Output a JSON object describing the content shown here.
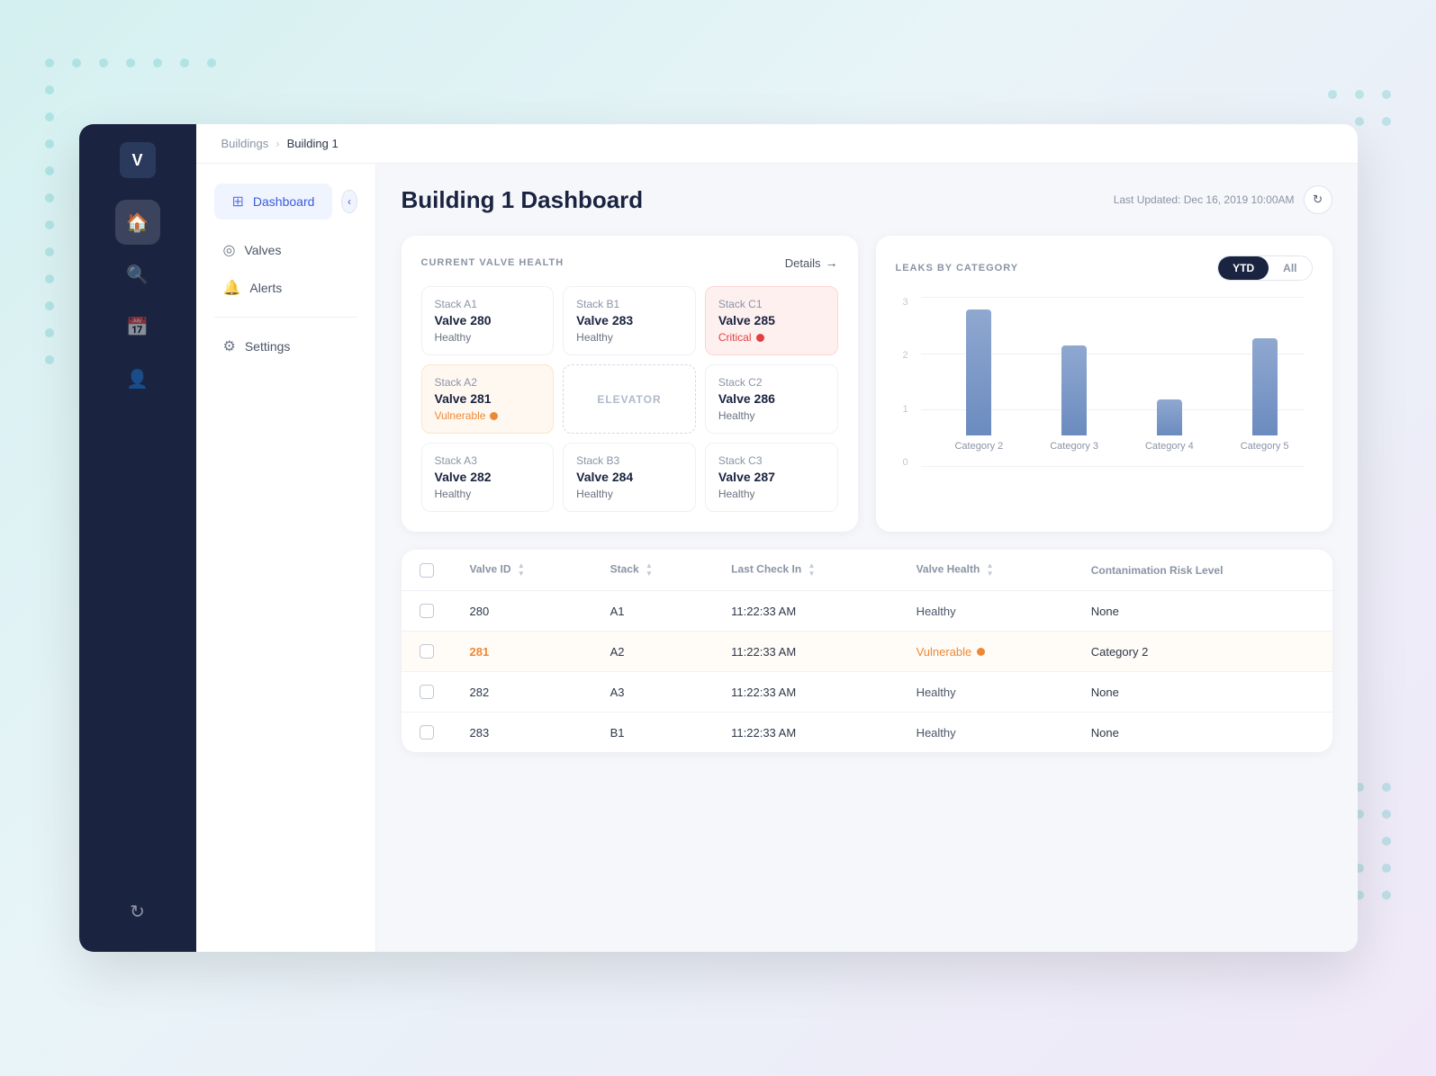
{
  "app": {
    "logo": "V"
  },
  "breadcrumb": {
    "parent": "Buildings",
    "current": "Building 1"
  },
  "sidebar_nav": {
    "items": [
      {
        "id": "home",
        "icon": "⊞",
        "label": "Dashboard",
        "active": true
      },
      {
        "id": "search",
        "icon": "⌕",
        "label": "Search",
        "active": false
      },
      {
        "id": "calendar",
        "icon": "▦",
        "label": "Calendar",
        "active": false
      },
      {
        "id": "user",
        "icon": "◉",
        "label": "Profile",
        "active": false
      }
    ]
  },
  "left_nav": {
    "items": [
      {
        "id": "dashboard",
        "icon": "⊞",
        "label": "Dashboard",
        "active": true
      },
      {
        "id": "valves",
        "icon": "◎",
        "label": "Valves",
        "active": false
      },
      {
        "id": "alerts",
        "icon": "🔔",
        "label": "Alerts",
        "active": false
      }
    ],
    "settings": {
      "icon": "⚙",
      "label": "Settings"
    },
    "collapse_label": "‹"
  },
  "dashboard": {
    "title": "Building 1 Dashboard",
    "last_updated_label": "Last Updated: Dec 16, 2019 10:00AM",
    "refresh_icon": "↻"
  },
  "valve_health": {
    "card_title": "CURRENT VALVE HEALTH",
    "details_label": "Details",
    "details_arrow": "→",
    "valves": [
      {
        "stack": "Stack A1",
        "name": "Valve 280",
        "status": "Healthy",
        "type": "healthy"
      },
      {
        "stack": "Stack B1",
        "name": "Valve 283",
        "status": "Healthy",
        "type": "healthy"
      },
      {
        "stack": "Stack C1",
        "name": "Valve 285",
        "status": "Critical",
        "type": "critical"
      },
      {
        "stack": "Stack A2",
        "name": "Valve 281",
        "status": "Vulnerable",
        "type": "vulnerable"
      },
      {
        "stack": "",
        "name": "ELEVATOR",
        "status": "",
        "type": "elevator"
      },
      {
        "stack": "Stack C2",
        "name": "Valve 286",
        "status": "Healthy",
        "type": "healthy"
      },
      {
        "stack": "Stack A3",
        "name": "Valve 282",
        "status": "Healthy",
        "type": "healthy"
      },
      {
        "stack": "Stack B3",
        "name": "Valve 284",
        "status": "Healthy",
        "type": "healthy"
      },
      {
        "stack": "Stack C3",
        "name": "Valve 287",
        "status": "Healthy",
        "type": "healthy"
      }
    ]
  },
  "leaks_chart": {
    "card_title": "LEAKS BY CATEGORY",
    "toggle_ytd": "YTD",
    "toggle_all": "All",
    "active_toggle": "YTD",
    "y_labels": [
      "3",
      "2",
      "1",
      "0"
    ],
    "bars": [
      {
        "label": "Category 2",
        "height_pct": 95
      },
      {
        "label": "Category 3",
        "height_pct": 70
      },
      {
        "label": "Category 4",
        "height_pct": 30
      },
      {
        "label": "Category 5",
        "height_pct": 75
      }
    ]
  },
  "table": {
    "columns": [
      {
        "id": "checkbox",
        "label": ""
      },
      {
        "id": "valve_id",
        "label": "Valve ID",
        "sortable": true
      },
      {
        "id": "stack",
        "label": "Stack",
        "sortable": true
      },
      {
        "id": "last_check_in",
        "label": "Last Check In",
        "sortable": true
      },
      {
        "id": "valve_health",
        "label": "Valve Health",
        "sortable": true
      },
      {
        "id": "risk_level",
        "label": "Contanimation Risk Level",
        "sortable": false
      }
    ],
    "rows": [
      {
        "valve_id": "280",
        "stack": "A1",
        "last_check_in": "11:22:33 AM",
        "health": "Healthy",
        "health_type": "healthy",
        "risk": "None",
        "highlighted": false
      },
      {
        "valve_id": "281",
        "stack": "A2",
        "last_check_in": "11:22:33 AM",
        "health": "Vulnerable",
        "health_type": "vulnerable",
        "risk": "Category 2",
        "highlighted": true
      },
      {
        "valve_id": "282",
        "stack": "A3",
        "last_check_in": "11:22:33 AM",
        "health": "Healthy",
        "health_type": "healthy",
        "risk": "None",
        "highlighted": false
      },
      {
        "valve_id": "283",
        "stack": "B1",
        "last_check_in": "11:22:33 AM",
        "health": "Healthy",
        "health_type": "healthy",
        "risk": "None",
        "highlighted": false
      }
    ]
  }
}
